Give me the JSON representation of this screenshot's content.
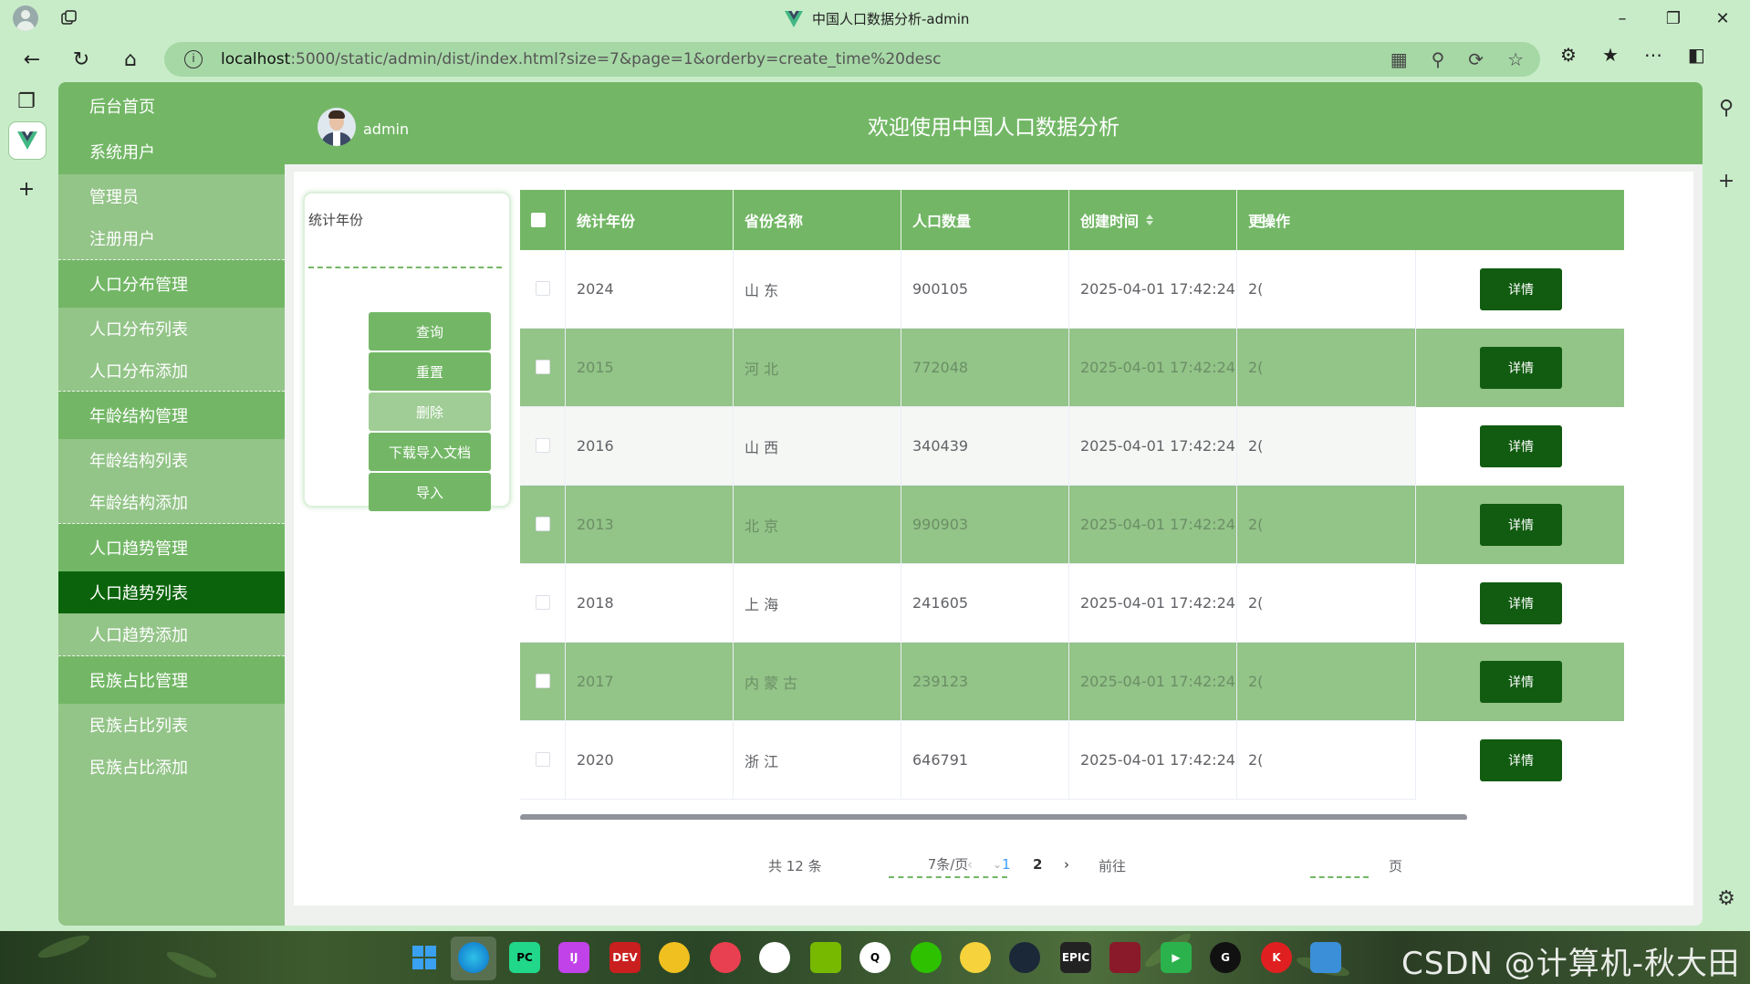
{
  "browser": {
    "title": "中国人口数据分析-admin",
    "url_host": "localhost",
    "url_rest": ":5000/static/admin/dist/index.html?size=7&page=1&orderby=create_time%20desc"
  },
  "sidebar": {
    "items": [
      {
        "label": "后台首页",
        "kind": "group"
      },
      {
        "label": "系统用户",
        "kind": "group"
      },
      {
        "label": "管理员",
        "kind": "sub"
      },
      {
        "label": "注册用户",
        "kind": "sub"
      },
      {
        "label": "人口分布管理",
        "kind": "group"
      },
      {
        "label": "人口分布列表",
        "kind": "sub"
      },
      {
        "label": "人口分布添加",
        "kind": "sub"
      },
      {
        "label": "年龄结构管理",
        "kind": "group"
      },
      {
        "label": "年龄结构列表",
        "kind": "sub"
      },
      {
        "label": "年龄结构添加",
        "kind": "sub"
      },
      {
        "label": "人口趋势管理",
        "kind": "group"
      },
      {
        "label": "人口趋势列表",
        "kind": "active"
      },
      {
        "label": "人口趋势添加",
        "kind": "sub"
      },
      {
        "label": "民族占比管理",
        "kind": "group"
      },
      {
        "label": "民族占比列表",
        "kind": "sub"
      },
      {
        "label": "民族占比添加",
        "kind": "sub"
      }
    ]
  },
  "header": {
    "username": "admin",
    "title": "欢迎使用中国人口数据分析"
  },
  "search": {
    "label": "统计年份",
    "value": "",
    "buttons": {
      "query": "查询",
      "reset": "重置",
      "delete": "删除",
      "download": "下载导入文档",
      "import": "导入"
    }
  },
  "table": {
    "headers": {
      "year": "统计年份",
      "province": "省份名称",
      "population": "人口数量",
      "created": "创建时间",
      "updated": "更",
      "ops": "操作"
    },
    "detail_label": "详情",
    "rows": [
      {
        "year": "2024",
        "province": "山 东",
        "population": "900105",
        "created": "2025-04-01 17:42:24",
        "updated": "2("
      },
      {
        "year": "2015",
        "province": "河 北",
        "population": "772048",
        "created": "2025-04-01 17:42:24",
        "updated": "2("
      },
      {
        "year": "2016",
        "province": "山 西",
        "population": "340439",
        "created": "2025-04-01 17:42:24",
        "updated": "2("
      },
      {
        "year": "2013",
        "province": "北 京",
        "population": "990903",
        "created": "2025-04-01 17:42:24",
        "updated": "2("
      },
      {
        "year": "2018",
        "province": "上 海",
        "population": "241605",
        "created": "2025-04-01 17:42:24",
        "updated": "2("
      },
      {
        "year": "2017",
        "province": "内 蒙 古",
        "population": "239123",
        "created": "2025-04-01 17:42:24",
        "updated": "2("
      },
      {
        "year": "2020",
        "province": "浙 江",
        "population": "646791",
        "created": "2025-04-01 17:42:24",
        "updated": "2("
      }
    ]
  },
  "pagination": {
    "total": "共 12 条",
    "page_size": "7条/页",
    "pages": [
      "1",
      "2"
    ],
    "current": "1",
    "goto": "前往",
    "page_suffix": "页"
  },
  "watermark": "CSDN @计算机-秋大田",
  "colors": {
    "primary": "#73b766",
    "sub_bg": "#93c488",
    "active": "#0b640b",
    "detail_btn": "#115c11"
  }
}
